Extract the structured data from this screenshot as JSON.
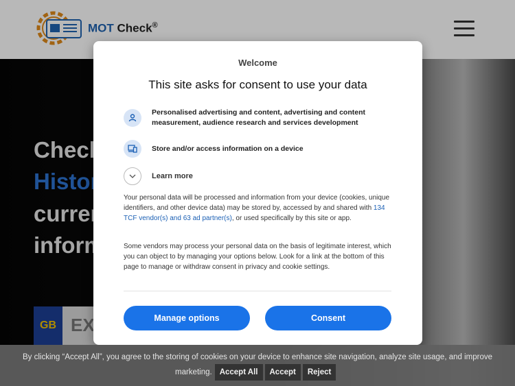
{
  "header": {
    "logo_text_mot": "MOT",
    "logo_text_check": "Check",
    "logo_reg": "®"
  },
  "hero": {
    "line1": "Check",
    "line2": "Histor",
    "line3": "curren",
    "line4": "inform",
    "plate_country": "GB",
    "plate_placeholder": "EX"
  },
  "dialog": {
    "welcome": "Welcome",
    "title": "This site asks for consent to use your data",
    "purposes": [
      {
        "icon": "person-icon",
        "text": "Personalised advertising and content, advertising and content measurement, audience research and services development"
      },
      {
        "icon": "device-icon",
        "text": "Store and/or access information on a device"
      }
    ],
    "learn_more": "Learn more",
    "para1_before": "Your personal data will be processed and information from your device (cookies, unique identifiers, and other device data) may be stored by, accessed by and shared with ",
    "para1_link": "134 TCF vendor(s) and 63 ad partner(s)",
    "para1_after": ", or used specifically by this site or app.",
    "para2": "Some vendors may process your personal data on the basis of legitimate interest, which you can object to by managing your options below. Look for a link at the bottom of this page to manage or withdraw consent in privacy and cookie settings.",
    "manage_label": "Manage options",
    "consent_label": "Consent"
  },
  "cookie_bar": {
    "text": "By clicking “Accept All”, you agree to the storing of cookies on your device to enhance site navigation, analyze site usage, and improve",
    "text2": "marketing.",
    "accept_all": "Accept All",
    "accept": "Accept",
    "reject": "Reject"
  },
  "colors": {
    "accent": "#1a73e8",
    "brand_blue": "#1f63b0",
    "plate_blue": "#1d3f95"
  }
}
